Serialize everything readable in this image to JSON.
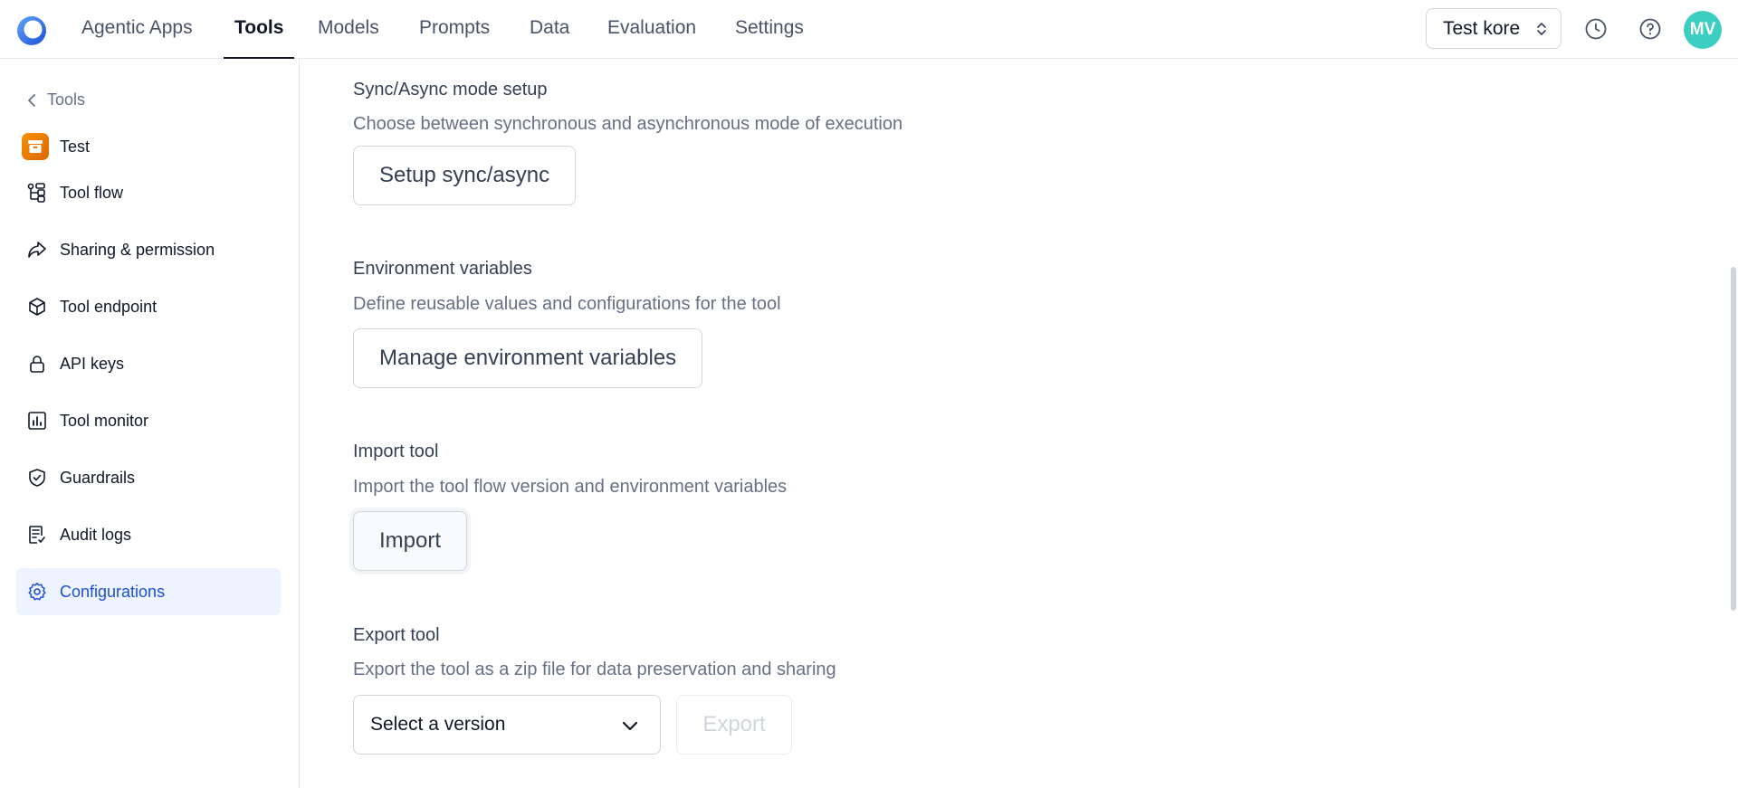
{
  "header": {
    "tabs": [
      {
        "label": "Agentic Apps"
      },
      {
        "label": "Tools"
      },
      {
        "label": "Models"
      },
      {
        "label": "Prompts"
      },
      {
        "label": "Data"
      },
      {
        "label": "Evaluation"
      },
      {
        "label": "Settings"
      }
    ],
    "active_tab": "Tools",
    "workspace": "Test kore",
    "avatar_initials": "MV",
    "icons": [
      "history-icon",
      "help-icon"
    ]
  },
  "sidebar": {
    "back_label": "Tools",
    "tool_name": "Test",
    "items": [
      {
        "label": "Tool flow",
        "icon": "flow-icon"
      },
      {
        "label": "Sharing & permission",
        "icon": "share-icon"
      },
      {
        "label": "Tool endpoint",
        "icon": "cube-icon"
      },
      {
        "label": "API keys",
        "icon": "lock-icon"
      },
      {
        "label": "Tool monitor",
        "icon": "chart-icon"
      },
      {
        "label": "Guardrails",
        "icon": "shield-icon"
      },
      {
        "label": "Audit logs",
        "icon": "log-icon"
      },
      {
        "label": "Configurations",
        "icon": "gear-icon"
      }
    ],
    "active_item": "Configurations"
  },
  "main": {
    "sync": {
      "title": "Sync/Async mode setup",
      "description": "Choose between synchronous and asynchronous mode of execution",
      "button": "Setup sync/async"
    },
    "env": {
      "title": "Environment variables",
      "description": "Define reusable values and configurations for the tool",
      "button": "Manage environment variables"
    },
    "import": {
      "title": "Import tool",
      "description": "Import the tool flow version and environment variables",
      "button": "Import"
    },
    "export": {
      "title": "Export tool",
      "description": "Export the tool as a zip file for data preservation and sharing",
      "select_placeholder": "Select a version",
      "button": "Export"
    }
  },
  "colors": {
    "accent": "#1d4ed8",
    "active_bg": "#eef4ff",
    "avatar": "#3ccfc1",
    "tool_badge": "#f79009"
  }
}
